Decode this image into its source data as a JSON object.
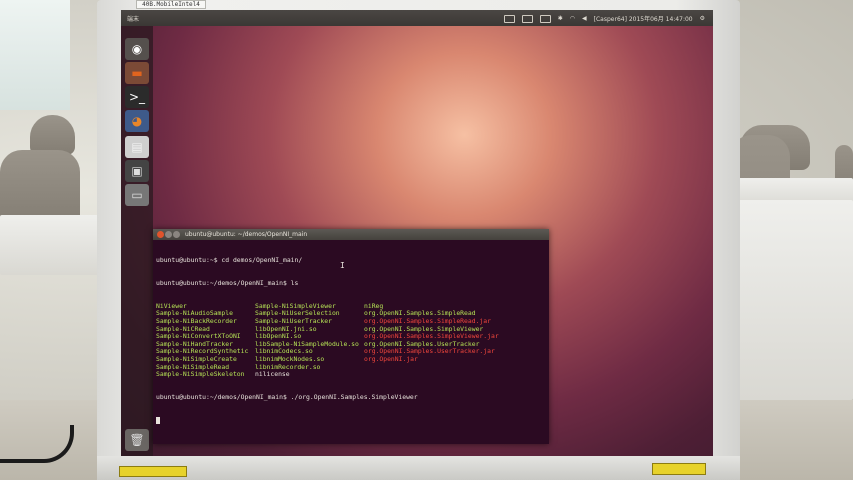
{
  "device": {
    "model_label": "40B.MobileIntel4",
    "sticker_labels": [
      "",
      ""
    ]
  },
  "top_panel": {
    "left_text": "端末",
    "right_text": "[Casper64] 2015年06月 14:47:00"
  },
  "launcher": {
    "items": [
      {
        "icon": "dash-home-icon",
        "glyph": "◉",
        "color": "#ffffff",
        "bg": "#55504d"
      },
      {
        "icon": "files-icon",
        "glyph": "▬",
        "color": "#e0641e",
        "bg": "#7b4a36"
      },
      {
        "icon": "terminal-icon",
        "glyph": ">_",
        "color": "#ffffff",
        "bg": "#2b2b2b"
      },
      {
        "icon": "firefox-icon",
        "glyph": "◕",
        "color": "#e8862a",
        "bg": "#3e5a8a"
      },
      {
        "icon": "document-icon",
        "glyph": "▤",
        "color": "#f0f0f0",
        "bg": "#cfcfcf"
      },
      {
        "icon": "terminal-app-icon",
        "glyph": "▣",
        "color": "#ddd",
        "bg": "#444"
      },
      {
        "icon": "drive-icon",
        "glyph": "▭",
        "color": "#ddd",
        "bg": "#777"
      }
    ],
    "trash_icon": "trash-icon"
  },
  "terminal": {
    "title": "ubuntu@ubuntu: ~/demos/OpenNI_main",
    "lines": [
      "ubuntu@ubuntu:~$ cd demos/OpenNI_main/",
      "ubuntu@ubuntu:~/demos/OpenNI_main$ ls"
    ],
    "listing": [
      [
        {
          "t": "NiViewer",
          "c": "g"
        },
        {
          "t": "Sample-NiSimpleViewer",
          "c": "g"
        },
        {
          "t": "niReg",
          "c": "g"
        }
      ],
      [
        {
          "t": "Sample-NiAudioSample",
          "c": "g"
        },
        {
          "t": "Sample-NiUserSelection",
          "c": "g"
        },
        {
          "t": "org.OpenNI.Samples.SimpleRead",
          "c": "g"
        }
      ],
      [
        {
          "t": "Sample-NiBackRecorder",
          "c": "g"
        },
        {
          "t": "Sample-NiUserTracker",
          "c": "g"
        },
        {
          "t": "org.OpenNI.Samples.SimpleRead.jar",
          "c": "r"
        }
      ],
      [
        {
          "t": "Sample-NiCRead",
          "c": "g"
        },
        {
          "t": "libOpenNI.jni.so",
          "c": "g"
        },
        {
          "t": "org.OpenNI.Samples.SimpleViewer",
          "c": "g"
        }
      ],
      [
        {
          "t": "Sample-NiConvertXToONI",
          "c": "g"
        },
        {
          "t": "libOpenNI.so",
          "c": "g"
        },
        {
          "t": "org.OpenNI.Samples.SimpleViewer.jar",
          "c": "r"
        }
      ],
      [
        {
          "t": "Sample-NiHandTracker",
          "c": "g"
        },
        {
          "t": "libSample-NiSampleModule.so",
          "c": "g"
        },
        {
          "t": "org.OpenNI.Samples.UserTracker",
          "c": "g"
        }
      ],
      [
        {
          "t": "Sample-NiRecordSynthetic",
          "c": "g"
        },
        {
          "t": "libnimCodecs.so",
          "c": "g"
        },
        {
          "t": "org.OpenNI.Samples.UserTracker.jar",
          "c": "r"
        }
      ],
      [
        {
          "t": "Sample-NiSimpleCreate",
          "c": "g"
        },
        {
          "t": "libnimMockNodes.so",
          "c": "g"
        },
        {
          "t": "org.OpenNI.jar",
          "c": "r"
        }
      ],
      [
        {
          "t": "Sample-NiSimpleRead",
          "c": "g"
        },
        {
          "t": "libnimRecorder.so",
          "c": "g"
        },
        {
          "t": "",
          "c": "w"
        }
      ],
      [
        {
          "t": "Sample-NiSimpleSkeleton",
          "c": "g"
        },
        {
          "t": "nilicense",
          "c": "w"
        },
        {
          "t": "",
          "c": "w"
        }
      ]
    ],
    "command": "ubuntu@ubuntu:~/demos/OpenNI_main$ ./org.OpenNI.Samples.SimpleViewer"
  }
}
